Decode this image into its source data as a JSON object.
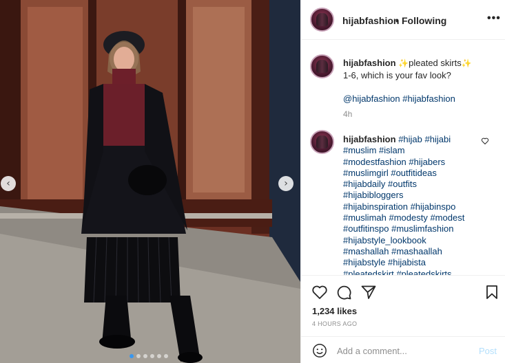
{
  "photo": {
    "prev_icon": "chevron-left-icon",
    "next_icon": "chevron-right-icon",
    "carousel_count": 6,
    "carousel_active": 1
  },
  "header": {
    "username": "hijabfashion",
    "separator": "•",
    "follow_status": "Following",
    "more_icon": "more-dots-icon",
    "more_label": "•••"
  },
  "caption": {
    "username": "hijabfashion",
    "sparkle_left": "✨",
    "text_main": "pleated skirts",
    "sparkle_right": "✨",
    "line2": "1-6, which is your fav look?",
    "mention1": "@hijabfashion",
    "hashtag1": "#hijabfashion",
    "time": "4h"
  },
  "comment": {
    "username": "hijabfashion",
    "lines": [
      "#hijab #hijabi",
      "#muslim #islam",
      "#modestfashion #hijabers",
      "#muslimgirl #outfitideas",
      "#hijabdaily #outfits",
      "#hijabibloggers",
      "#hijabinspiration #hijabinspo",
      "#muslimah #modesty #modest",
      "#outfitinspo #muslimfashion",
      "#hijabstyle_lookbook",
      "#mashallah #mashaallah",
      "#hijabstyle #hijabista",
      "#pleatedskirt #pleatedskirts"
    ],
    "like_icon": "heart-outline-icon"
  },
  "actions": {
    "like_icon": "heart-icon",
    "comment_icon": "comment-icon",
    "share_icon": "share-icon",
    "save_icon": "bookmark-icon",
    "likes": "1,234 likes",
    "time_ago": "4 HOURS AGO"
  },
  "add_comment": {
    "emoji_icon": "smiley-icon",
    "placeholder": "Add a comment...",
    "post_label": "Post"
  },
  "colors": {
    "link": "#00376b",
    "post_disabled": "#b2dffc",
    "muted": "#8e8e8e",
    "carousel_active": "#3897f0"
  }
}
